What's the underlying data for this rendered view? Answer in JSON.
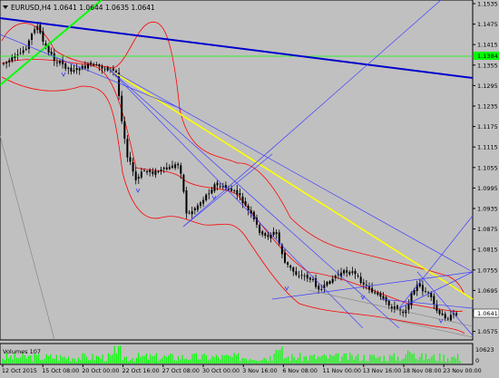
{
  "window": {
    "symbol_menu_icon": "triangle-down-icon",
    "symbol_header": "EURUSD,H4  1.0641 1.0644 1.0635 1.0641"
  },
  "main_axis": {
    "price_ticks": [
      "1.1535",
      "1.1475",
      "1.1415",
      "1.1355",
      "1.1295",
      "1.1235",
      "1.1175",
      "1.1115",
      "1.1055",
      "1.0995",
      "1.0935",
      "1.0875",
      "1.0815",
      "1.0755",
      "1.0695",
      "1.0635",
      "1.0575"
    ],
    "horizontal_line_label": "1.1384",
    "current_price_label": "1.0641"
  },
  "volume_panel": {
    "label": "Volumes 107",
    "ticks": [
      "10623",
      "0"
    ]
  },
  "time_axis": {
    "labels": [
      "12 Oct 2015",
      "15 Oct 08:00",
      "20 Oct 00:00",
      "22 Oct 16:00",
      "27 Oct 08:00",
      "30 Oct 00:00",
      "3 Nov 16:00",
      "6 Nov 08:00",
      "11 Nov 00:00",
      "13 Nov 16:00",
      "18 Nov 08:00",
      "23 Nov 00:00"
    ]
  },
  "colors": {
    "background": "#c0c0c0",
    "candles": "#000000",
    "bollinger": "#ff0000",
    "main_trendline": "#0000cd",
    "channel_lines": "#4040ff",
    "yellow_line": "#ffff00",
    "green_line": "#00ff00",
    "horizontal_line": "#00ff00",
    "volume_bars": "#00ff00",
    "price_label_bg": "#ffffff"
  }
}
